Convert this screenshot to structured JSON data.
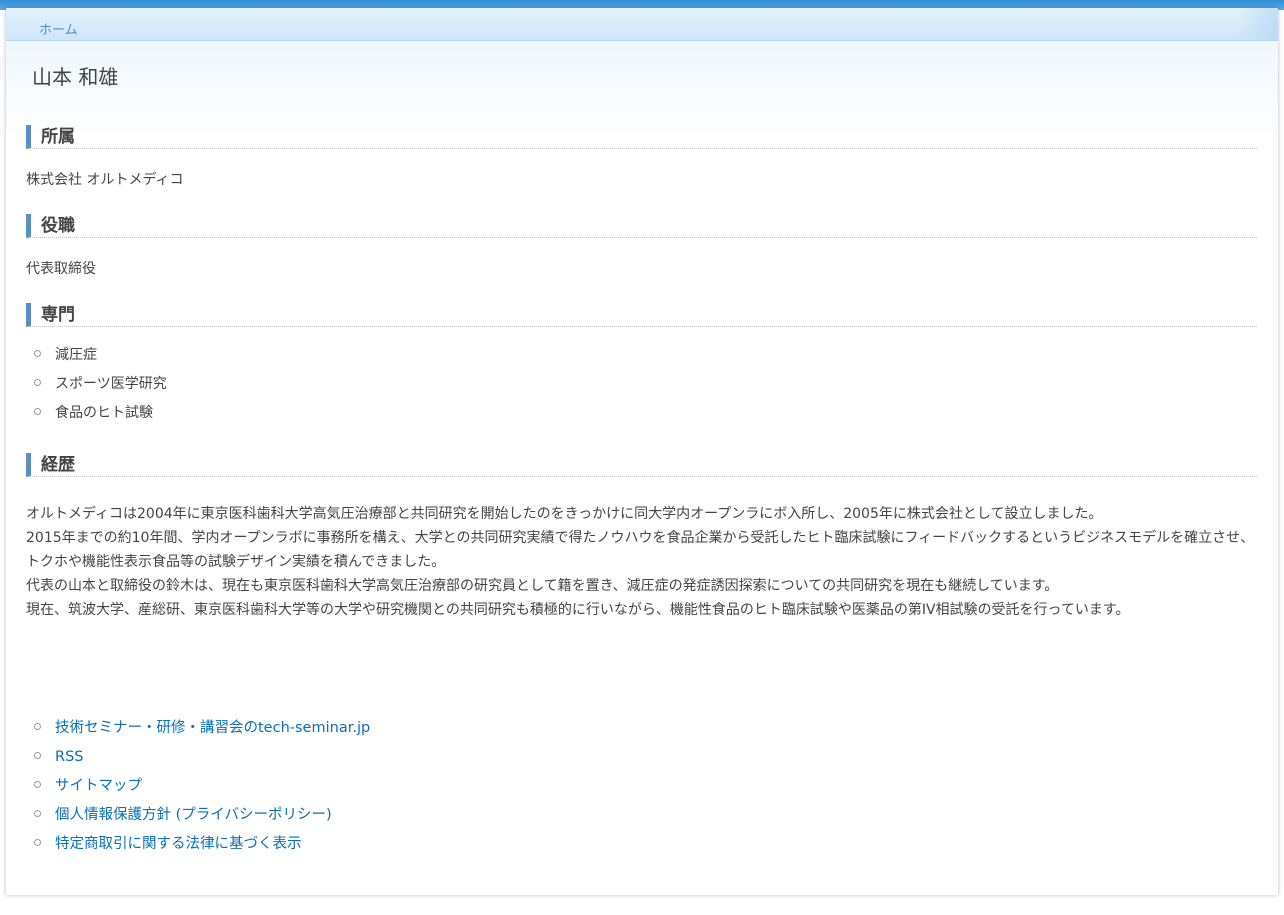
{
  "breadcrumb": {
    "home_label": "ホーム"
  },
  "page_title": "山本 和雄",
  "sections": {
    "affiliation": {
      "heading": "所属",
      "text": "株式会社 オルトメディコ"
    },
    "position": {
      "heading": "役職",
      "text": "代表取締役"
    },
    "specialty": {
      "heading": "専門",
      "items": [
        "減圧症",
        "スポーツ医学研究",
        "食品のヒト試験"
      ]
    },
    "history": {
      "heading": "経歴",
      "paragraphs": [
        "オルトメディコは2004年に東京医科歯科大学高気圧治療部と共同研究を開始したのをきっかけに同大学内オープンラにボ入所し、2005年に株式会社として設立しました。",
        "2015年までの約10年間、学内オープンラボに事務所を構え、大学との共同研究実績で得たノウハウを食品企業から受託したヒト臨床試験にフィードバックするというビジネスモデルを確立させ、トクホや機能性表示食品等の試験デザイン実績を積んできました。",
        "代表の山本と取締役の鈴木は、現在も東京医科歯科大学高気圧治療部の研究員として籍を置き、減圧症の発症誘因探索についての共同研究を現在も継続しています。",
        "現在、筑波大学、産総研、東京医科歯科大学等の大学や研究機関との共同研究も積極的に行いながら、機能性食品のヒト臨床試験や医薬品の第IV相試験の受託を行っています。"
      ]
    }
  },
  "footer_links": [
    "技術セミナー・研修・講習会のtech-seminar.jp",
    "RSS",
    "サイトマップ",
    "個人情報保護方針 (プライバシーポリシー)",
    "特定商取引に関する法律に基づく表示"
  ],
  "colors": {
    "top_bar": "#2f8fd8",
    "heading_accent": "#5a8fc4",
    "link": "#0a6fb8",
    "breadcrumb_link": "#4a90c8"
  }
}
